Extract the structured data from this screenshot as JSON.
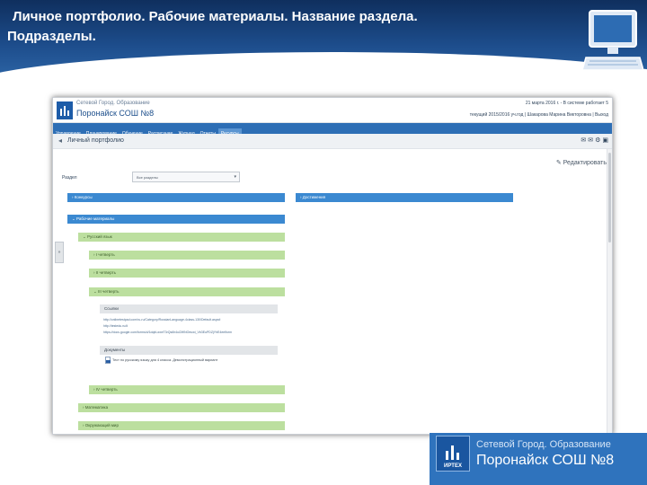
{
  "slide": {
    "title_line1": "Личное портфолио.  Рабочие материалы. Название раздела.",
    "title_line2": "Подразделы."
  },
  "app": {
    "network_name": "Сетевой Город. Образование",
    "school_name": "Поронайск СОШ №8",
    "header_right_top": "21 марта 2016 г. - В системе работает 5",
    "header_right_bottom": "текущий 2015/2016 уч.год  |  Шакарова Марина Викторовна  |  Выход",
    "menu": [
      "Управление",
      "Планирование",
      "Обучение",
      "Расписание",
      "Журнал",
      "Отчеты",
      "Ресурсы"
    ],
    "active_menu": "Ресурсы",
    "breadcrumb": "Личный портфолио",
    "edit_label": "Редактировать",
    "section_label": "Раздел",
    "section_value": "Все разделы",
    "blocks": {
      "konkursy": "Конкурсы",
      "dostizheniya": "Достижения",
      "rabochie": "Рабочие материалы",
      "russkiy": "Русский язык",
      "q1": "I четверть",
      "q2": "II четверть",
      "q3": "III четверть",
      "links_header": "Ссылки",
      "docs_header": "Документы",
      "q4": "IV четверть",
      "matematika": "Математика",
      "okruzhayushchiy": "Окружающий мир"
    },
    "links": [
      "http://onlinetestpad.com/ru-ru/Category/RussianLanguage-4class-130/Default.aspx#",
      "http://testedu.ru/#",
      "https://docs.google.com/forms/d/1dqbLwxeT3rQs6h4ul2WNOeuwi_Vb3EuPDZjYhE4eelform"
    ],
    "document": "Тест по русскому языку для 4 класса. Демонстрационный вариант"
  },
  "logo": {
    "mark": "ИРТЕХ",
    "line1": "Сетевой Город. Образование",
    "line2": "Поронайск СОШ №8"
  }
}
